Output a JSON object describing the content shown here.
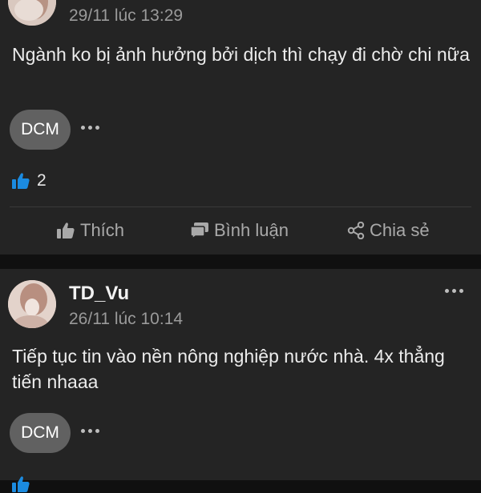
{
  "post1": {
    "timestamp": "29/11 lúc 13:29",
    "text": "Ngành ko bị ảnh hưởng bởi dịch thì chạy đi chờ chi nữa",
    "tag": "DCM",
    "like_count": "2",
    "actions": {
      "like": "Thích",
      "comment": "Bình luận",
      "share": "Chia sẻ"
    }
  },
  "post2": {
    "author": "TD_Vu",
    "timestamp": "26/11 lúc 10:14",
    "text": "Tiếp tục tin vào nền nông nghiệp nước nhà. 4x thẳng tiến nhaaa",
    "tag": "DCM"
  },
  "icons": [
    "thumbs-up-icon",
    "comment-icon",
    "share-icon",
    "more-icon"
  ],
  "colors": {
    "background": "#242424",
    "like_blue": "#1b8be0",
    "pill": "#616161"
  }
}
